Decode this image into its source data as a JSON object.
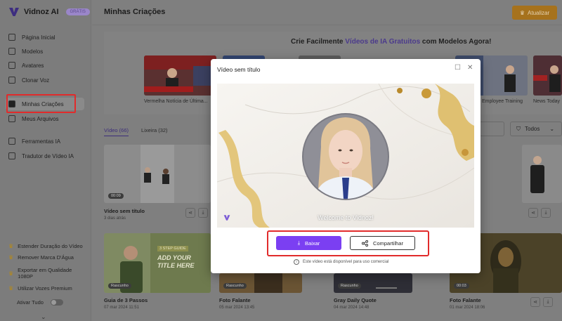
{
  "brand": {
    "name": "Vidnoz AI",
    "badge": "GRÁTIS"
  },
  "sidebar": {
    "items": [
      {
        "label": "Página Inicial",
        "icon": "home-icon"
      },
      {
        "label": "Modelos",
        "icon": "template-icon"
      },
      {
        "label": "Avatares",
        "icon": "avatar-icon"
      },
      {
        "label": "Clonar Voz",
        "icon": "voice-icon"
      },
      {
        "label": "Minhas Criações",
        "icon": "video-icon",
        "active": true
      },
      {
        "label": "Meus Arquivos",
        "icon": "cloud-icon"
      },
      {
        "label": "Ferramentas IA",
        "icon": "tools-icon"
      },
      {
        "label": "Tradutor de Vídeo IA",
        "icon": "translate-icon"
      }
    ],
    "promos": [
      "Estender Duração do Vídeo",
      "Remover Marca D'Água",
      "Exportar em Qualidade 1080P",
      "Utilizar Vozes Premium"
    ],
    "toggle_label": "Ativar Tudo",
    "expand_icon": "chevron-down-icon"
  },
  "header": {
    "title": "Minhas Criações",
    "upgrade_label": "Atualizar",
    "upgrade_icon": "crown-icon"
  },
  "banner": {
    "title_pre": "Crie Facilmente ",
    "title_accent": "Vídeos de IA Gratuitos",
    "title_post": " com Modelos Agora!",
    "thumbnails": [
      "Vermelha Notícia de Última...",
      "Employee Training",
      "News Today"
    ]
  },
  "tabs": [
    {
      "label": "Vídeo (66)",
      "active": true
    },
    {
      "label": "Lixeira (32)",
      "active": false
    }
  ],
  "filter": {
    "label": "Todos",
    "icon": "filter-icon"
  },
  "cards": [
    {
      "title": "Vídeo sem título",
      "date": "3 dias atrás",
      "duration": "00:09"
    },
    {
      "title": "Guia de 3 Passos",
      "date": "07 mar 2024 11:51",
      "tag": "Rascunho",
      "overlay_small": "3 STEP GUIDE",
      "overlay_big": "ADD YOUR TITLE HERE"
    },
    {
      "title": "Foto Falante",
      "date": "05 mar 2024 13:45",
      "tag": "Rascunho"
    },
    {
      "title": "Gray Daily Quote",
      "date": "04 mar 2024 14:48",
      "tag": "Rascunho"
    },
    {
      "title": "Foto Falante",
      "date": "01 mar 2024 18:06",
      "duration": "00:03"
    }
  ],
  "modal": {
    "title": "Vídeo sem título",
    "watermark": "Welcome to Vidnoz!",
    "download_label": "Baixar",
    "share_label": "Compartilhar",
    "note": "Este vídeo está disponível para uso comercial",
    "highlight_color": "#e12b2b",
    "accent_color": "#7b3ff2"
  }
}
